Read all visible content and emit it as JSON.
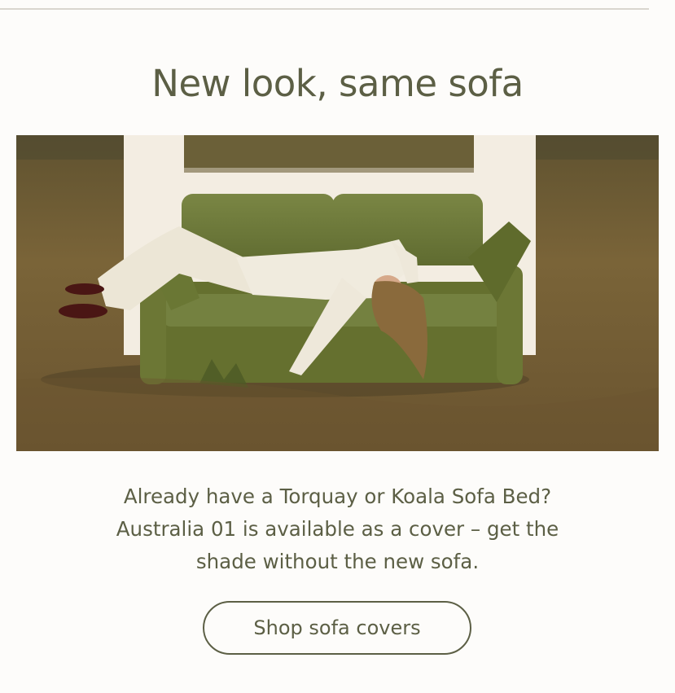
{
  "header": {
    "title": "New look, same sofa"
  },
  "hero": {
    "image_subject": "woman-lying-on-green-sofa-in-field",
    "colors": {
      "grass": "#6e5a34",
      "sofa": "#6f7b3a",
      "panel": "#f3ede2"
    }
  },
  "body": {
    "line1": "Already have a Torquay or Koala Sofa Bed?",
    "line2": "Australia 01 is available as a cover – get the",
    "line3": "shade without the new sofa."
  },
  "cta": {
    "label": "Shop sofa covers"
  },
  "colors": {
    "accent": "#5c5f45",
    "background": "#fdfcfa"
  }
}
